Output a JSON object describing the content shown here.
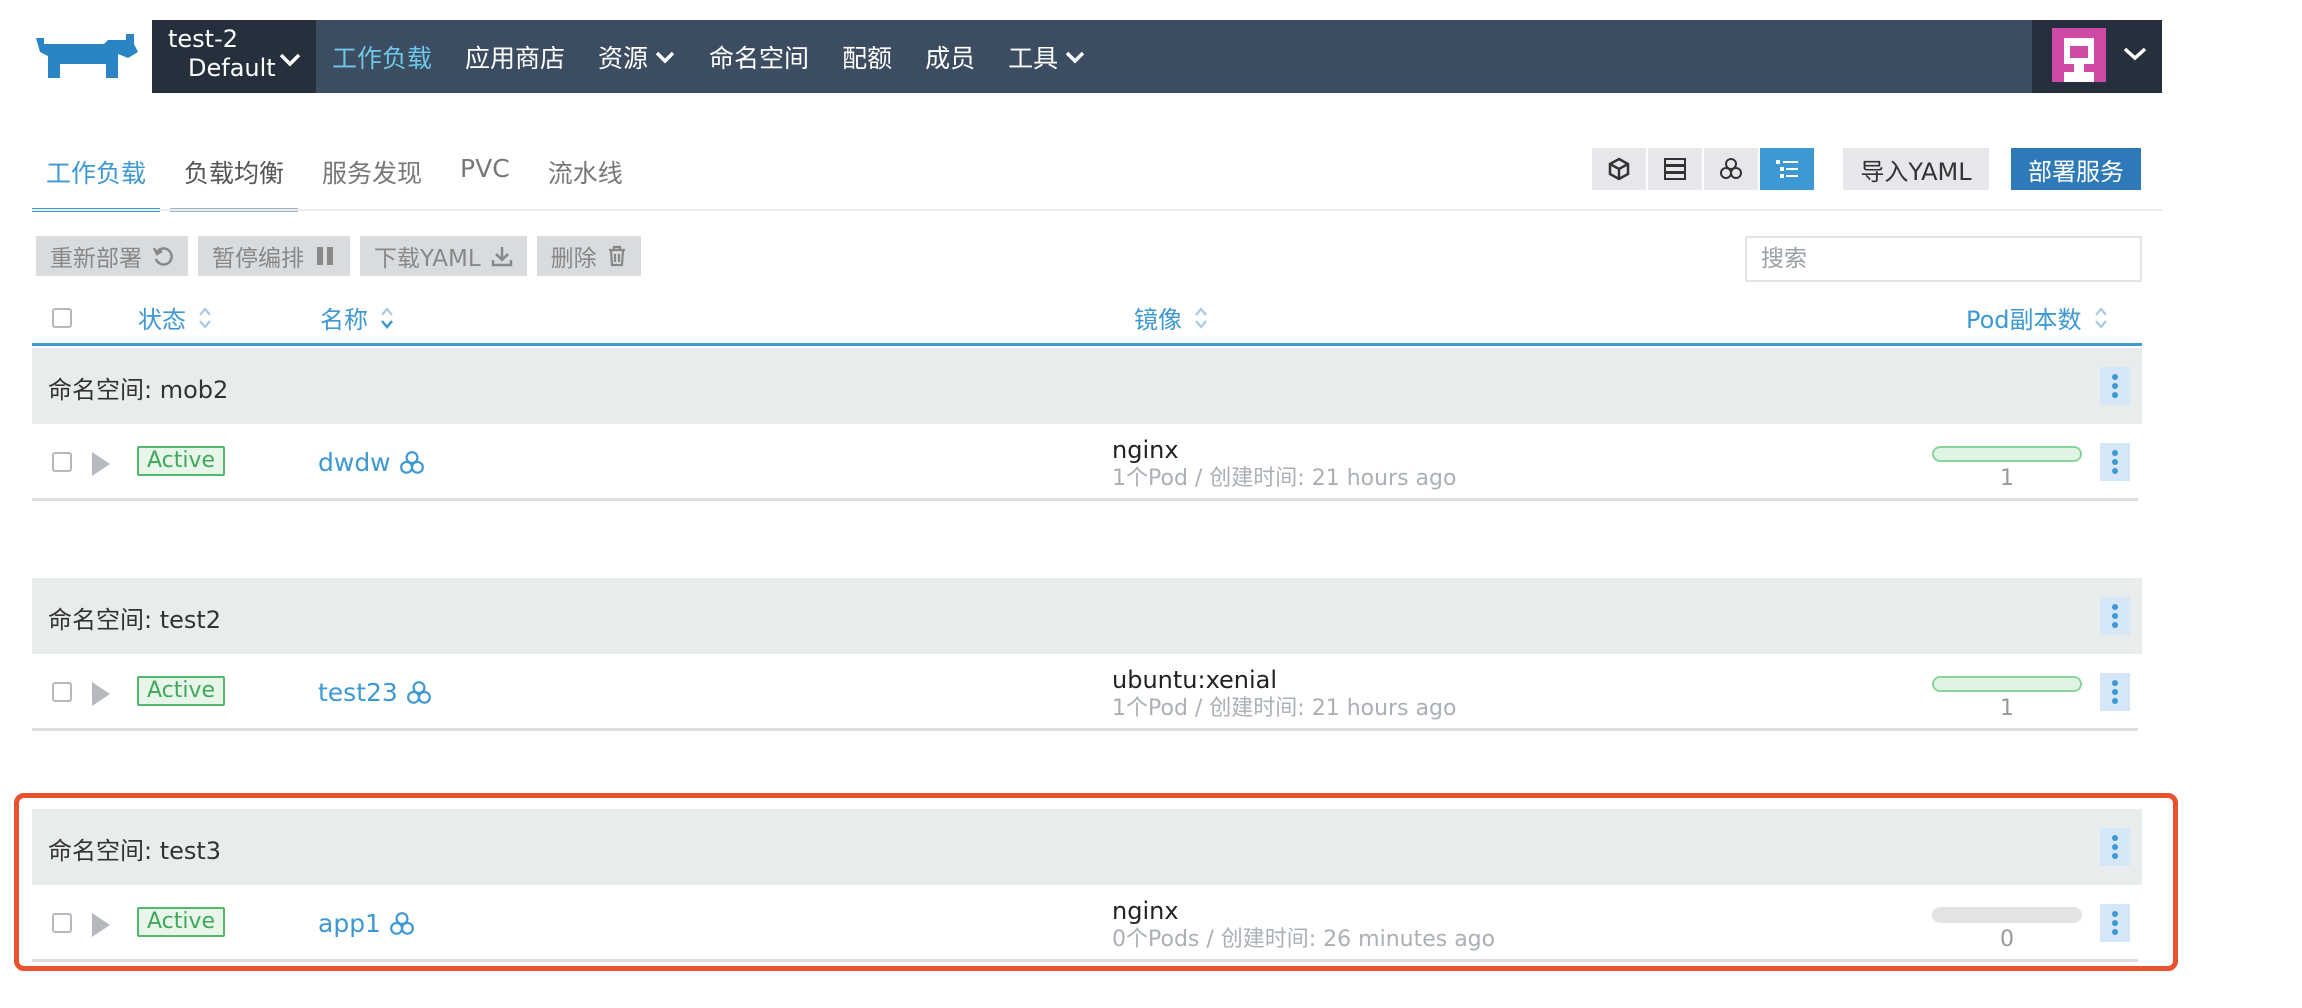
{
  "header": {
    "cluster": {
      "name": "test-2",
      "project": "Default"
    },
    "nav": [
      {
        "label": "工作负载",
        "active": true,
        "dropdown": false
      },
      {
        "label": "应用商店",
        "active": false,
        "dropdown": false
      },
      {
        "label": "资源",
        "active": false,
        "dropdown": true
      },
      {
        "label": "命名空间",
        "active": false,
        "dropdown": false
      },
      {
        "label": "配额",
        "active": false,
        "dropdown": false
      },
      {
        "label": "成员",
        "active": false,
        "dropdown": false
      },
      {
        "label": "工具",
        "active": false,
        "dropdown": true
      }
    ],
    "colors": {
      "bar": "#3c4d62",
      "dark": "#26303c",
      "accent": "#6ec6e8"
    }
  },
  "tabs": [
    {
      "label": "工作负载",
      "state": "active"
    },
    {
      "label": "负载均衡",
      "state": "hover"
    },
    {
      "label": "服务发现",
      "state": "normal"
    },
    {
      "label": "PVC",
      "state": "normal"
    },
    {
      "label": "流水线",
      "state": "normal"
    }
  ],
  "view_switch": [
    "cube-icon",
    "server-icon",
    "cluster-icon",
    "list-icon"
  ],
  "actions": {
    "import_yaml": "导入YAML",
    "deploy": "部署服务"
  },
  "bulk": [
    {
      "label": "重新部署",
      "icon": "redeploy-icon"
    },
    {
      "label": "暂停编排",
      "icon": "pause-icon"
    },
    {
      "label": "下载YAML",
      "icon": "download-icon"
    },
    {
      "label": "删除",
      "icon": "trash-icon"
    }
  ],
  "search": {
    "placeholder": "搜索",
    "value": ""
  },
  "table": {
    "columns": {
      "state": "状态",
      "name": "名称",
      "image": "镜像",
      "pods": "Pod副本数"
    },
    "groups": [
      {
        "namespace": "命名空间: mob2",
        "workloads": [
          {
            "state": "Active",
            "name": "dwdw",
            "image": "nginx",
            "meta": "1个Pod / 创建时间: 21 hours ago",
            "pods": "1",
            "pod_ratio": 1
          }
        ]
      },
      {
        "namespace": "命名空间: test2",
        "workloads": [
          {
            "state": "Active",
            "name": "test23",
            "image": "ubuntu:xenial",
            "meta": "1个Pod / 创建时间: 21 hours ago",
            "pods": "1",
            "pod_ratio": 1
          }
        ]
      },
      {
        "namespace": "命名空间: test3",
        "highlighted": true,
        "workloads": [
          {
            "state": "Active",
            "name": "app1",
            "image": "nginx",
            "meta": "0个Pods / 创建时间: 26 minutes ago",
            "pods": "0",
            "pod_ratio": 0
          }
        ]
      }
    ]
  },
  "colors": {
    "link": "#3d98d3",
    "active_badge": "#3fa85b",
    "highlight": "#e8532e",
    "primary_button": "#2e7ab8"
  }
}
